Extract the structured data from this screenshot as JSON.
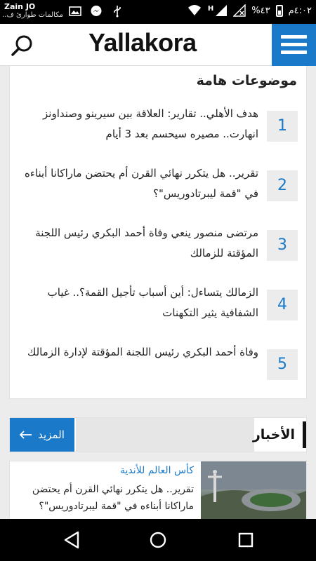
{
  "status_bar": {
    "carrier": "Zain JO",
    "notification": "مكالمات طوارئ ف...",
    "network": "H",
    "battery": "%٤٣",
    "time": "٤:٠٢م"
  },
  "header": {
    "logo": "Yallakora"
  },
  "important": {
    "title": "موضوعات هامة",
    "items": [
      {
        "num": "1",
        "text": "هدف الأهلي.. تقارير: العلاقة بين سيرينو وصنداونز انهارت.. مصيره سيحسم بعد 3 أيام"
      },
      {
        "num": "2",
        "text": "تقرير.. هل يتكرر نهائي القرن أم يحتضن ماراكانا أبناءه في \"قمة ليبرتادوريس\"؟"
      },
      {
        "num": "3",
        "text": "مرتضى منصور ينعي وفاة أحمد البكري رئيس اللجنة المؤقتة للزمالك"
      },
      {
        "num": "4",
        "text": "الزمالك يتساءل: أين أسباب تأجيل القمة؟.. غياب الشفافية يثير التكهنات"
      },
      {
        "num": "5",
        "text": "وفاة أحمد البكري رئيس اللجنة المؤقتة لإدارة الزمالك"
      }
    ]
  },
  "news": {
    "title": "الأخبار",
    "more_label": "المزيد",
    "item": {
      "category": "كأس العالم للأندية",
      "text": "تقرير.. هل يتكرر نهائي القرن أم يحتضن ماراكانا أبناءه في \"قمة ليبرتادوريس\"؟"
    }
  },
  "colors": {
    "accent": "#1b79c9"
  }
}
